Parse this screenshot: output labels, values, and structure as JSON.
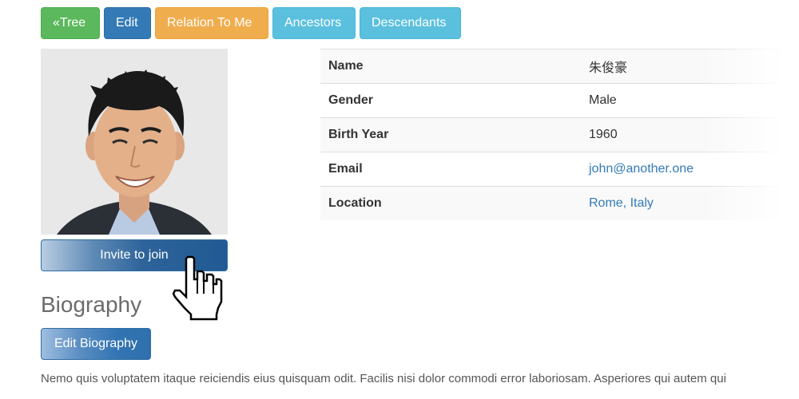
{
  "toolbar": {
    "tree_label": "«Tree",
    "edit_label": "Edit",
    "relation_label": "Relation To Me",
    "ancestors_label": "Ancestors",
    "descendants_label": "Descendants"
  },
  "profile": {
    "invite_label": "Invite to join",
    "fields": [
      {
        "label": "Name",
        "value": "朱俊豪"
      },
      {
        "label": "Gender",
        "value": "Male"
      },
      {
        "label": "Birth Year",
        "value": "1960"
      },
      {
        "label": "Email",
        "value": "john@another.one"
      },
      {
        "label": "Location",
        "value": "Rome, Italy"
      }
    ]
  },
  "biography": {
    "title": "Biography",
    "edit_label": "Edit Biography",
    "text": "Nemo quis voluptatem itaque reiciendis eius quisquam odit. Facilis nisi dolor commodi error laboriosam. Asperiores qui autem qui"
  },
  "colors": {
    "success": "#5cb85c",
    "primary": "#337ab7",
    "warning": "#f0ad4e",
    "info": "#5bc0de",
    "link": "#337ab7"
  }
}
